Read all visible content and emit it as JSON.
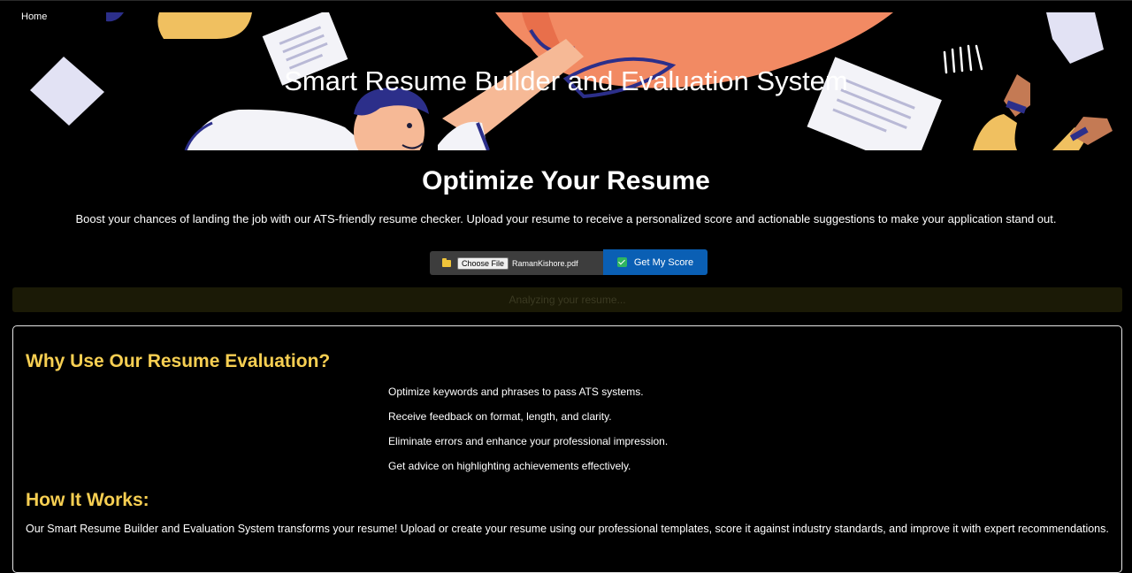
{
  "nav": {
    "home_label": "Home"
  },
  "hero": {
    "title": "Smart Resume Builder and Evaluation System"
  },
  "main": {
    "headline": "Optimize Your Resume",
    "subtext": "Boost your chances of landing the job with our ATS-friendly resume checker. Upload your resume to receive a personalized score and actionable suggestions to make your application stand out."
  },
  "upload": {
    "choose_label": "Choose File",
    "file_name": "RamanKishore.pdf",
    "score_label": "Get My Score"
  },
  "status": {
    "text": "Analyzing your resume..."
  },
  "why": {
    "title": "Why Use Our Resume Evaluation?",
    "items": [
      "Optimize keywords and phrases to pass ATS systems.",
      "Receive feedback on format, length, and clarity.",
      "Eliminate errors and enhance your professional impression.",
      "Get advice on highlighting achievements effectively."
    ]
  },
  "how": {
    "title": "How It Works:",
    "text": "Our Smart Resume Builder and Evaluation System transforms your resume! Upload or create your resume using our professional templates, score it against industry standards, and improve it with expert recommendations."
  },
  "colors": {
    "accent_yellow": "#f7cf52",
    "button_blue": "#0a5fb4",
    "hero_orange": "#f28a63"
  }
}
